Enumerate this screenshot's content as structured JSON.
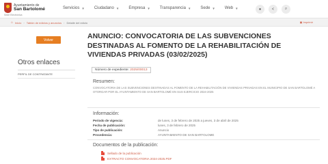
{
  "header": {
    "logo": {
      "line1": "Ayuntamiento de",
      "line2": "San Bartolomé",
      "line3": "Sede Electrónica"
    },
    "nav": [
      {
        "label": "Servicios"
      },
      {
        "label": "Ciudadano"
      },
      {
        "label": "Empresa"
      },
      {
        "label": "Transparencia"
      },
      {
        "label": "Sede"
      },
      {
        "label": "Web"
      }
    ],
    "icons": [
      "settings-icon",
      "share-icon",
      "search-icon"
    ]
  },
  "breadcrumb": {
    "items": [
      "Inicio",
      "Tablón de edictos y anuncios",
      "Detalle del edicto"
    ],
    "print_label": "Imprimir"
  },
  "sidebar": {
    "back_label": "Volver",
    "title": "Otros enlaces",
    "links": [
      "Perfil de contratante"
    ]
  },
  "main": {
    "title": "ANUNCIO: CONVOCATORIA DE LAS SUBVENCIONES DESTINADAS AL FOMENTO DE LA REHABILITACIÓN DE VIVIENDAS PRIVADAS (03/02/2025)",
    "expediente_label": "Número de expediente:",
    "expediente_value": "2025/00013",
    "resumen_heading": "Resumen:",
    "resumen_text": "CONVOCATORIA DE LAS SUBVENCIONES DESTINADAS AL FOMENTO DE LA REHABILITACIÓN DE VIVIENDAS PRIVADAS EN EL MUNICIPIO DE SAN BARTOLOMÉ A OTORGAR POR EL AYUNTAMIENTO DE SAN BARTOLOMÉ EN SUS EJERCICIO 2024-2025",
    "info_heading": "Información:",
    "info": [
      {
        "label": "Periodo de vigencia:",
        "value": "de lunes, 3 de febrero de 2025 a jueves, 3 de abril de 2025"
      },
      {
        "label": "Fecha de publicación:",
        "value": "lunes, 3 de febrero de 2025"
      },
      {
        "label": "Tipo de publicación:",
        "value": "Anuncio"
      },
      {
        "label": "Procedencia:",
        "value": "AYUNTAMIENTO DE SAN BARTOLOME"
      }
    ],
    "docs_heading": "Documentos de la publicación:",
    "docs": [
      {
        "label": "Sellado de la publicación"
      },
      {
        "label": "EXTRACTO CONVOCATORIA 2024-2025.PDF"
      }
    ]
  },
  "colors": {
    "accent": "#e67e22",
    "link": "#d0604a"
  }
}
